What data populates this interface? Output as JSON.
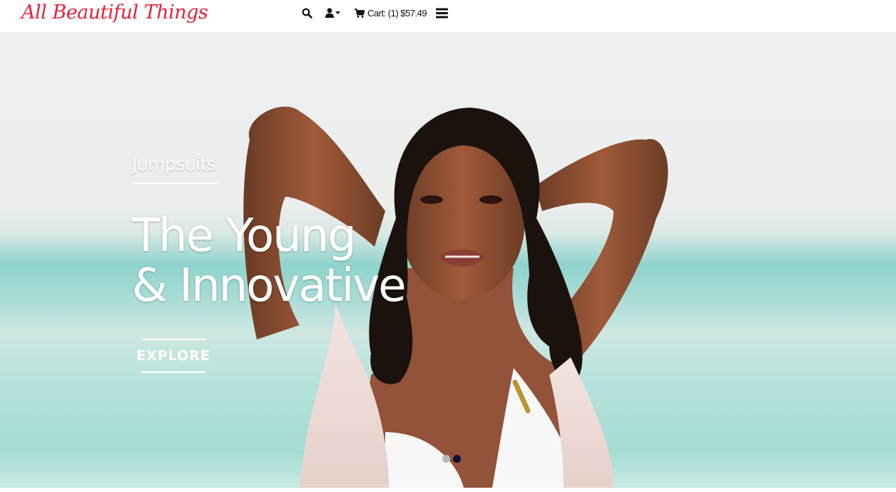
{
  "header": {
    "logo_text": "All Beautiful Things",
    "cart_label": "Cart: (1) $57.49"
  },
  "icons": {
    "search": "search-icon",
    "user": "user-icon",
    "caret": "caret-down-icon",
    "cart": "cart-icon",
    "menu": "hamburger-menu-icon"
  },
  "hero": {
    "category": "Jumpsuits",
    "headline_line1": "The Young",
    "headline_line2": "& Innovative",
    "cta_label": "EXPLORE",
    "slides_total": 2,
    "active_slide": 2
  },
  "colors": {
    "brand": "#e8203a",
    "dot_active": "#0c1030",
    "dot_inactive": "#b8b8b8"
  }
}
